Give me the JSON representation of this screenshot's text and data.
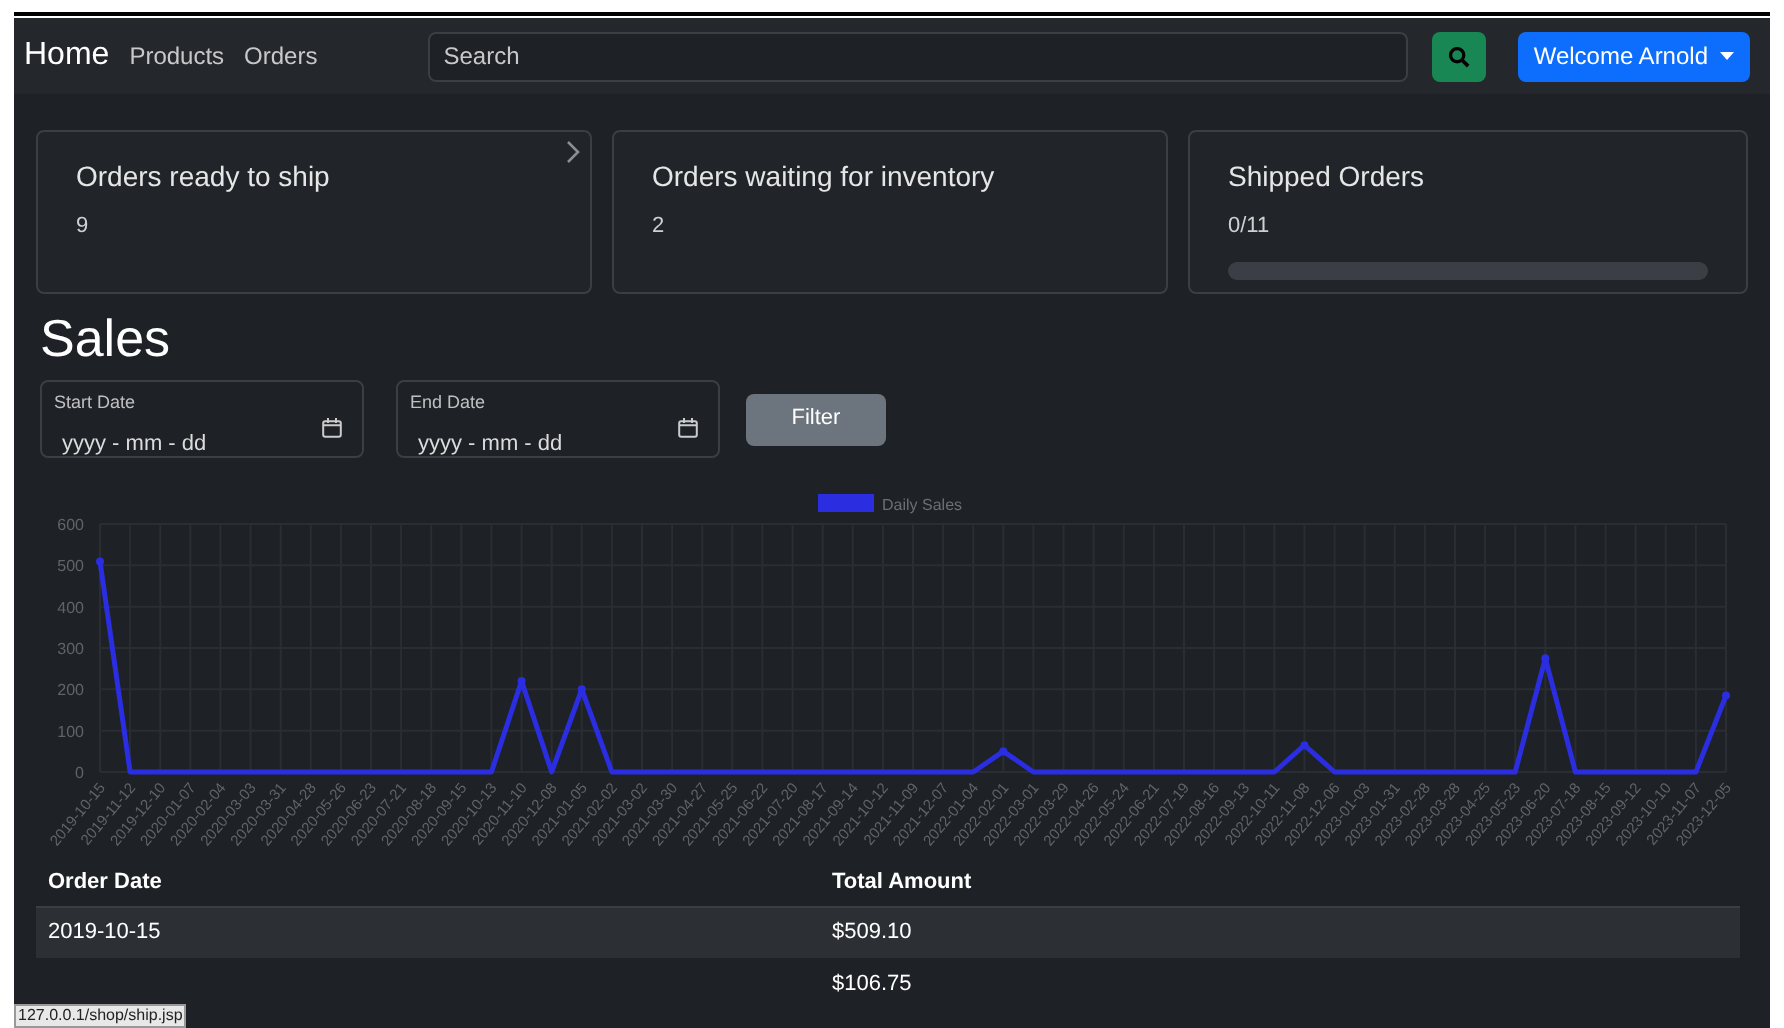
{
  "navbar": {
    "brand": "Home",
    "links": [
      "Products",
      "Orders"
    ],
    "search": {
      "placeholder": "Search"
    },
    "user_menu": "Welcome Arnold"
  },
  "cards": [
    {
      "title": "Orders ready to ship",
      "value": "9",
      "kind": "link"
    },
    {
      "title": "Orders waiting for inventory",
      "value": "2",
      "kind": "plain"
    },
    {
      "title": "Shipped Orders",
      "value": "0/11",
      "kind": "progress",
      "level": 0
    }
  ],
  "sales": {
    "title": "Sales",
    "filters": [
      {
        "label": "Start Date",
        "placeholder": "yyyy - mm - dd"
      },
      {
        "label": "End Date",
        "placeholder": "yyyy - mm - dd"
      }
    ],
    "filter_button": "Filter",
    "chart_data": {
      "type": "line",
      "categories": [
        "2019-10-15",
        "2019-11-12",
        "2019-12-10",
        "2020-01-07",
        "2020-02-04",
        "2020-03-03",
        "2020-03-31",
        "2020-04-28",
        "2020-05-26",
        "2020-06-23",
        "2020-07-21",
        "2020-08-18",
        "2020-09-15",
        "2020-10-13",
        "2020-11-10",
        "2020-12-08",
        "2021-01-05",
        "2021-02-02",
        "2021-03-02",
        "2021-03-30",
        "2021-04-27",
        "2021-05-25",
        "2021-06-22",
        "2021-07-20",
        "2021-08-17",
        "2021-09-14",
        "2021-10-12",
        "2021-11-09",
        "2021-12-07",
        "2022-01-04",
        "2022-02-01",
        "2022-03-01",
        "2022-03-29",
        "2022-04-26",
        "2022-05-24",
        "2022-06-21",
        "2022-07-19",
        "2022-08-16",
        "2022-09-13",
        "2022-10-11",
        "2022-11-08",
        "2022-12-06",
        "2023-01-03",
        "2023-01-31",
        "2023-02-28",
        "2023-03-28",
        "2023-04-25",
        "2023-05-23",
        "2023-06-20",
        "2023-07-18",
        "2023-08-15",
        "2023-09-12",
        "2023-10-10",
        "2023-11-07",
        "2023-12-05"
      ],
      "series": [
        {
          "name": "Daily Sales",
          "color": "#2a2ee0",
          "values": [
            509,
            0,
            0,
            0,
            0,
            0,
            0,
            0,
            0,
            0,
            0,
            0,
            0,
            0,
            220,
            0,
            200,
            0,
            0,
            0,
            0,
            0,
            0,
            0,
            0,
            0,
            0,
            0,
            0,
            0,
            50,
            0,
            0,
            0,
            0,
            0,
            0,
            0,
            0,
            0,
            65,
            0,
            0,
            0,
            0,
            0,
            0,
            0,
            275,
            0,
            0,
            0,
            0,
            0,
            185
          ]
        }
      ],
      "grid": true,
      "ylim": [
        0,
        600
      ],
      "yticks": [
        0,
        100,
        200,
        300,
        400,
        500,
        600
      ]
    },
    "table": {
      "columns": [
        "Order Date",
        "Total Amount"
      ],
      "rows": [
        {
          "order_date": "2019-10-15",
          "total_amount": "$509.10"
        },
        {
          "total_amount": "$106.75"
        }
      ]
    }
  },
  "status_bar": "127.0.0.1/shop/ship.jsp"
}
